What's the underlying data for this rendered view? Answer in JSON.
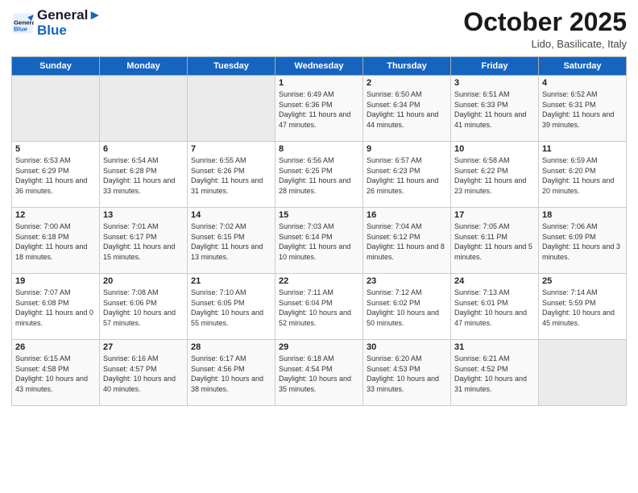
{
  "header": {
    "logo_line1": "General",
    "logo_line2": "Blue",
    "month": "October 2025",
    "location": "Lido, Basilicate, Italy"
  },
  "weekdays": [
    "Sunday",
    "Monday",
    "Tuesday",
    "Wednesday",
    "Thursday",
    "Friday",
    "Saturday"
  ],
  "weeks": [
    [
      {
        "day": "",
        "info": ""
      },
      {
        "day": "",
        "info": ""
      },
      {
        "day": "",
        "info": ""
      },
      {
        "day": "1",
        "info": "Sunrise: 6:49 AM\nSunset: 6:36 PM\nDaylight: 11 hours and 47 minutes."
      },
      {
        "day": "2",
        "info": "Sunrise: 6:50 AM\nSunset: 6:34 PM\nDaylight: 11 hours and 44 minutes."
      },
      {
        "day": "3",
        "info": "Sunrise: 6:51 AM\nSunset: 6:33 PM\nDaylight: 11 hours and 41 minutes."
      },
      {
        "day": "4",
        "info": "Sunrise: 6:52 AM\nSunset: 6:31 PM\nDaylight: 11 hours and 39 minutes."
      }
    ],
    [
      {
        "day": "5",
        "info": "Sunrise: 6:53 AM\nSunset: 6:29 PM\nDaylight: 11 hours and 36 minutes."
      },
      {
        "day": "6",
        "info": "Sunrise: 6:54 AM\nSunset: 6:28 PM\nDaylight: 11 hours and 33 minutes."
      },
      {
        "day": "7",
        "info": "Sunrise: 6:55 AM\nSunset: 6:26 PM\nDaylight: 11 hours and 31 minutes."
      },
      {
        "day": "8",
        "info": "Sunrise: 6:56 AM\nSunset: 6:25 PM\nDaylight: 11 hours and 28 minutes."
      },
      {
        "day": "9",
        "info": "Sunrise: 6:57 AM\nSunset: 6:23 PM\nDaylight: 11 hours and 26 minutes."
      },
      {
        "day": "10",
        "info": "Sunrise: 6:58 AM\nSunset: 6:22 PM\nDaylight: 11 hours and 23 minutes."
      },
      {
        "day": "11",
        "info": "Sunrise: 6:59 AM\nSunset: 6:20 PM\nDaylight: 11 hours and 20 minutes."
      }
    ],
    [
      {
        "day": "12",
        "info": "Sunrise: 7:00 AM\nSunset: 6:18 PM\nDaylight: 11 hours and 18 minutes."
      },
      {
        "day": "13",
        "info": "Sunrise: 7:01 AM\nSunset: 6:17 PM\nDaylight: 11 hours and 15 minutes."
      },
      {
        "day": "14",
        "info": "Sunrise: 7:02 AM\nSunset: 6:15 PM\nDaylight: 11 hours and 13 minutes."
      },
      {
        "day": "15",
        "info": "Sunrise: 7:03 AM\nSunset: 6:14 PM\nDaylight: 11 hours and 10 minutes."
      },
      {
        "day": "16",
        "info": "Sunrise: 7:04 AM\nSunset: 6:12 PM\nDaylight: 11 hours and 8 minutes."
      },
      {
        "day": "17",
        "info": "Sunrise: 7:05 AM\nSunset: 6:11 PM\nDaylight: 11 hours and 5 minutes."
      },
      {
        "day": "18",
        "info": "Sunrise: 7:06 AM\nSunset: 6:09 PM\nDaylight: 11 hours and 3 minutes."
      }
    ],
    [
      {
        "day": "19",
        "info": "Sunrise: 7:07 AM\nSunset: 6:08 PM\nDaylight: 11 hours and 0 minutes."
      },
      {
        "day": "20",
        "info": "Sunrise: 7:08 AM\nSunset: 6:06 PM\nDaylight: 10 hours and 57 minutes."
      },
      {
        "day": "21",
        "info": "Sunrise: 7:10 AM\nSunset: 6:05 PM\nDaylight: 10 hours and 55 minutes."
      },
      {
        "day": "22",
        "info": "Sunrise: 7:11 AM\nSunset: 6:04 PM\nDaylight: 10 hours and 52 minutes."
      },
      {
        "day": "23",
        "info": "Sunrise: 7:12 AM\nSunset: 6:02 PM\nDaylight: 10 hours and 50 minutes."
      },
      {
        "day": "24",
        "info": "Sunrise: 7:13 AM\nSunset: 6:01 PM\nDaylight: 10 hours and 47 minutes."
      },
      {
        "day": "25",
        "info": "Sunrise: 7:14 AM\nSunset: 5:59 PM\nDaylight: 10 hours and 45 minutes."
      }
    ],
    [
      {
        "day": "26",
        "info": "Sunrise: 6:15 AM\nSunset: 4:58 PM\nDaylight: 10 hours and 43 minutes."
      },
      {
        "day": "27",
        "info": "Sunrise: 6:16 AM\nSunset: 4:57 PM\nDaylight: 10 hours and 40 minutes."
      },
      {
        "day": "28",
        "info": "Sunrise: 6:17 AM\nSunset: 4:56 PM\nDaylight: 10 hours and 38 minutes."
      },
      {
        "day": "29",
        "info": "Sunrise: 6:18 AM\nSunset: 4:54 PM\nDaylight: 10 hours and 35 minutes."
      },
      {
        "day": "30",
        "info": "Sunrise: 6:20 AM\nSunset: 4:53 PM\nDaylight: 10 hours and 33 minutes."
      },
      {
        "day": "31",
        "info": "Sunrise: 6:21 AM\nSunset: 4:52 PM\nDaylight: 10 hours and 31 minutes."
      },
      {
        "day": "",
        "info": ""
      }
    ]
  ]
}
